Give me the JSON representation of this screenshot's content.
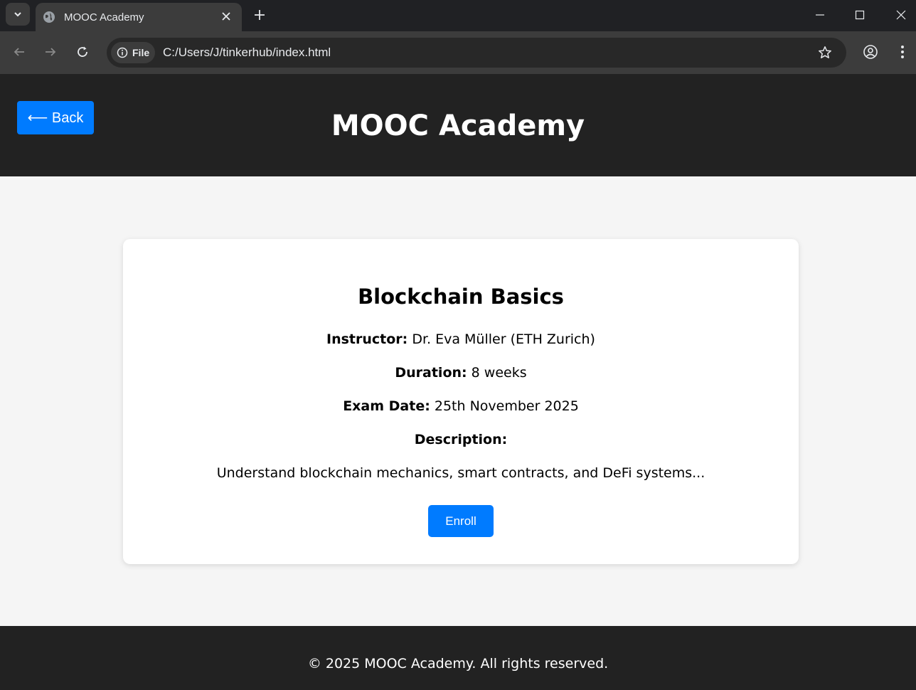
{
  "browser": {
    "tab": {
      "title": "MOOC Academy"
    },
    "address_bar": {
      "chip_label": "File",
      "url": "C:/Users/J/tinkerhub/index.html"
    }
  },
  "header": {
    "back_label": "⟵ Back",
    "site_title": "MOOC Academy"
  },
  "course": {
    "title": "Blockchain Basics",
    "instructor_label": "Instructor:",
    "instructor_value": " Dr. Eva Müller (ETH Zurich)",
    "duration_label": "Duration:",
    "duration_value": " 8 weeks",
    "exam_label": "Exam Date:",
    "exam_value": " 25th November 2025",
    "description_label": "Description:",
    "description_text": "Understand blockchain mechanics, smart contracts, and DeFi systems...",
    "enroll_label": "Enroll"
  },
  "footer": {
    "text": "© 2025 MOOC Academy. All rights reserved."
  },
  "colors": {
    "primary_button": "#007bff",
    "header_bg": "#222222",
    "page_bg": "#f5f5f5"
  }
}
